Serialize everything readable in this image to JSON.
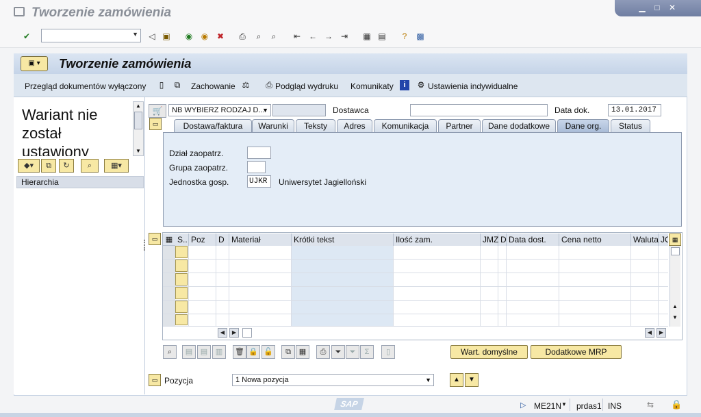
{
  "window": {
    "title": "Tworzenie zamówienia",
    "controls": [
      "minimize-icon",
      "maximize-icon",
      "close-icon"
    ]
  },
  "toolbar": {
    "command_value": "",
    "icons": [
      "check-icon",
      "back-icon",
      "save-icon",
      "undo-icon",
      "exit-icon",
      "cancel-icon",
      "print-icon",
      "find-icon",
      "find-next-icon",
      "first-page-icon",
      "prev-page-icon",
      "next-page-icon",
      "last-page-icon",
      "new-session-icon",
      "shortcut-icon",
      "help-icon",
      "layout-icon"
    ]
  },
  "screen": {
    "title": "Tworzenie zamówienia"
  },
  "app_toolbar": {
    "doc_overview": "Przegląd dokumentów wyłączony",
    "hold": "Zachowanie",
    "print_preview": "Podgląd wydruku",
    "messages": "Komunikaty",
    "personal_settings": "Ustawienia indywidualne"
  },
  "left_pane": {
    "variant_text": "Wariant nie został ustawiony",
    "hierarchy_header": "Hierarchia"
  },
  "header": {
    "doc_type_value": "NB WYBIERZ RODZAJ D...",
    "doc_number_value": "",
    "supplier_label": "Dostawca",
    "supplier_value": "",
    "doc_date_label": "Data dok.",
    "doc_date_value": "13.01.2017"
  },
  "tabs": [
    {
      "label": "Dostawa/faktura"
    },
    {
      "label": "Warunki"
    },
    {
      "label": "Teksty"
    },
    {
      "label": "Adres"
    },
    {
      "label": "Komunikacja"
    },
    {
      "label": "Partner"
    },
    {
      "label": "Dane dodatkowe"
    },
    {
      "label": "Dane org."
    },
    {
      "label": "Status"
    }
  ],
  "org_data": {
    "purch_org_label": "Dział zaopatrz.",
    "purch_org_value": "",
    "purch_group_label": "Grupa zaopatrz.",
    "purch_group_value": "",
    "company_code_label": "Jednostka gosp.",
    "company_code_value": "UJKR",
    "company_code_desc": "Uniwersytet Jagielloński"
  },
  "grid": {
    "columns": [
      "S..",
      "Poz",
      "D",
      "Materiał",
      "Krótki tekst",
      "Ilość zam.",
      "JMZ",
      "D",
      "Data dost.",
      "Cena netto",
      "Waluta",
      "JC"
    ],
    "row_count": 6
  },
  "bottom": {
    "default_values_button": "Wart. domyślne",
    "additional_mrp_button": "Dodatkowe MRP",
    "item_label": "Pozycja",
    "item_select_value": "1 Nowa pozycja"
  },
  "status": {
    "transaction": "ME21N",
    "system": "prdas1",
    "mode": "INS",
    "logo": "SAP"
  }
}
